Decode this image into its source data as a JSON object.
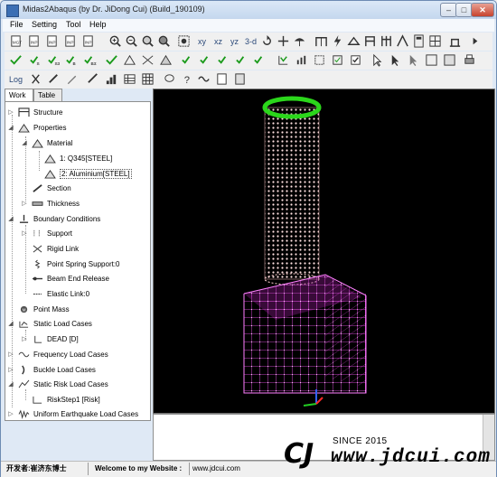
{
  "window": {
    "title": "Midas2Abaqus (by Dr. JiDong Cui) (Build_190109)",
    "min": "–",
    "max": "□",
    "close": "✕"
  },
  "menu": [
    "File",
    "Setting",
    "Tool",
    "Help"
  ],
  "toolbar": {
    "row1_text": [
      "xy",
      "xz",
      "yz",
      "3-d"
    ],
    "row2_text": [
      "Log"
    ]
  },
  "tabs": [
    "Work",
    "Table"
  ],
  "tree": {
    "structure": "Structure",
    "properties": "Properties",
    "material": "Material",
    "mat1": "1: Q345[STEEL]",
    "mat2": "2: Aluminium[STEEL]",
    "section": "Section",
    "thickness": "Thickness",
    "boundary": "Boundary Conditions",
    "support": "Support",
    "rigid_link": "Rigid Link",
    "point_spring": "Point Spring Support:0",
    "beam_end": "Beam End Release",
    "elastic_link": "Elastic Link:0",
    "point_mass": "Point Mass",
    "static_load": "Static Load Cases",
    "dead": "DEAD [D]",
    "freq_load": "Frequency Load Cases",
    "buckle_load": "Buckle Load Cases",
    "static_risk": "Static Risk Load Cases",
    "risk_step": "RiskStep1 [Risk]",
    "uniform_eq": "Uniform Earthquake Load Cases"
  },
  "status": {
    "developer": "开发者:崔济东博士",
    "welcome": "Welcome to my Website :",
    "url": "www.jdcui.com"
  },
  "watermark": {
    "logo": "CJ",
    "since": "SINCE 2015",
    "url": "www.jdcui.com"
  },
  "colors": {
    "viewport_bg": "#000000",
    "cube_color": "#ff4dff",
    "tube_color": "#ffd6d6",
    "ring_color": "#2bd61b"
  }
}
